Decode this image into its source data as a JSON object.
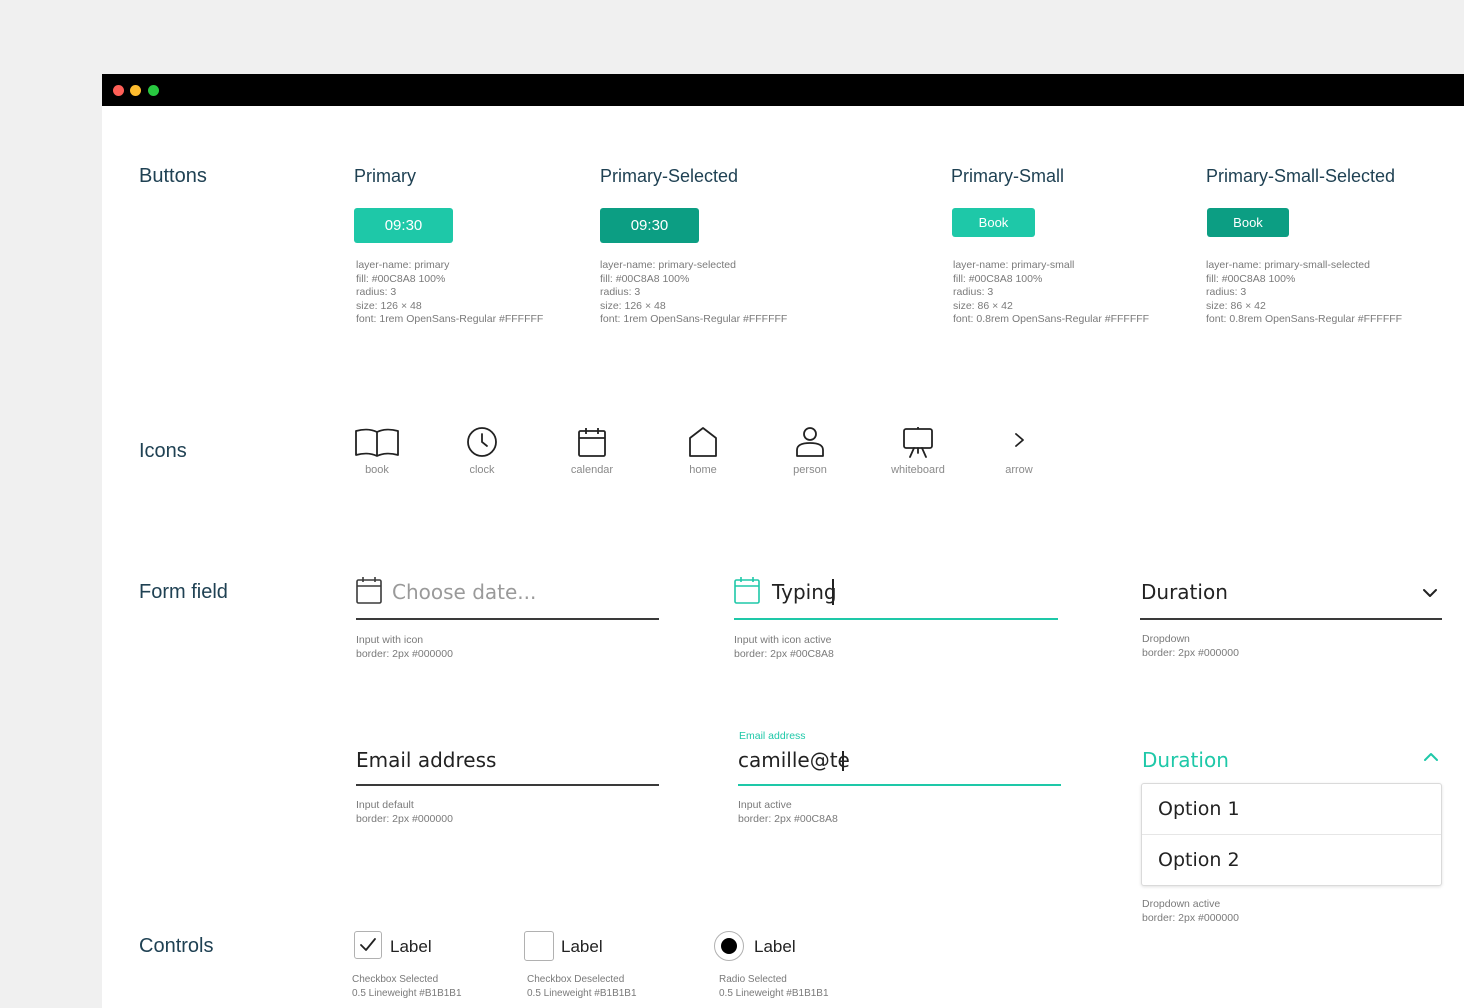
{
  "window": {
    "controls": [
      "close",
      "minimize",
      "maximize"
    ],
    "colors": [
      "#ff5f57",
      "#febc2e",
      "#28c840"
    ]
  },
  "sections": {
    "buttons": "Buttons",
    "icons": "Icons",
    "form_field": "Form field",
    "controls": "Controls"
  },
  "buttons": [
    {
      "title": "Primary",
      "label": "09:30",
      "spec": "layer-name: primary\nfill: #00C8A8 100%\nradius: 3\nsize: 126 × 48\nfont: 1rem OpenSans-Regular #FFFFFF",
      "color": "#1ec8a8"
    },
    {
      "title": "Primary-Selected",
      "label": "09:30",
      "spec": "layer-name: primary-selected\nfill: #00C8A8 100%\nradius: 3\nsize: 126 × 48\nfont: 1rem OpenSans-Regular #FFFFFF",
      "color": "#0c9e83"
    },
    {
      "title": "Primary-Small",
      "label": "Book",
      "spec": "layer-name: primary-small\nfill: #00C8A8 100%\nradius: 3\nsize: 86 × 42\nfont: 0.8rem OpenSans-Regular #FFFFFF",
      "color": "#1ec8a8"
    },
    {
      "title": "Primary-Small-Selected",
      "label": "Book",
      "spec": "layer-name: primary-small-selected\nfill: #00C8A8 100%\nradius: 3\nsize: 86 × 42\nfont: 0.8rem OpenSans-Regular #FFFFFF",
      "color": "#0c9e83"
    }
  ],
  "icons": [
    {
      "name": "book-icon",
      "label": "book"
    },
    {
      "name": "clock-icon",
      "label": "clock"
    },
    {
      "name": "calendar-icon",
      "label": "calendar"
    },
    {
      "name": "home-icon",
      "label": "home"
    },
    {
      "name": "person-icon",
      "label": "person"
    },
    {
      "name": "whiteboard-icon",
      "label": "whiteboard"
    },
    {
      "name": "arrow-icon",
      "label": "arrow"
    }
  ],
  "form": {
    "input_icon": {
      "placeholder": "Choose date...",
      "spec": "Input with icon\nborder: 2px #000000"
    },
    "input_icon_active": {
      "value": "Typing",
      "spec": "Input with icon active\nborder: 2px #00C8A8"
    },
    "dropdown": {
      "value": "Duration",
      "spec": "Dropdown\nborder: 2px #000000"
    },
    "input_default": {
      "placeholder": "Email address",
      "spec": "Input default\nborder: 2px #000000"
    },
    "input_active": {
      "label": "Email address",
      "value": "camille@te",
      "spec": "Input active\nborder: 2px #00C8A8"
    },
    "dropdown_active": {
      "value": "Duration",
      "options": [
        "Option 1",
        "Option 2"
      ],
      "spec": "Dropdown active\nborder: 2px #000000"
    }
  },
  "controls": [
    {
      "label": "Label",
      "checked": true,
      "spec": "Checkbox Selected\n0.5 Lineweight #B1B1B1"
    },
    {
      "label": "Label",
      "checked": false,
      "spec": "Checkbox Deselected\n0.5 Lineweight #B1B1B1"
    },
    {
      "label": "Label",
      "checked": true,
      "spec": "Radio Selected\n0.5 Lineweight #B1B1B1"
    }
  ],
  "accent": "#1ec8a8",
  "accent_dark": "#0c9e83",
  "heading_color": "#1f4153"
}
